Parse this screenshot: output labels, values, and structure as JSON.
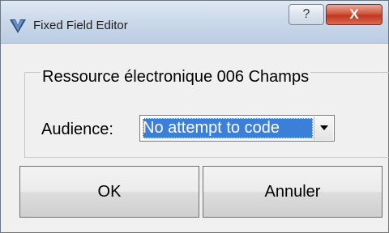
{
  "window": {
    "title": "Fixed Field Editor",
    "help_glyph": "?",
    "close_glyph": "X"
  },
  "group": {
    "label": "Ressource électronique 006 Champs"
  },
  "audience": {
    "label": "Audience:",
    "selected_value": "No attempt to code"
  },
  "buttons": {
    "ok": "OK",
    "cancel": "Annuler"
  },
  "icons": {
    "app": "app-logo-icon",
    "help": "help-icon",
    "close": "close-icon",
    "dropdown": "chevron-down-icon"
  },
  "colors": {
    "selection": "#3c7fd8",
    "close_button": "#c2361f",
    "titlebar": "#cbd9ea"
  }
}
